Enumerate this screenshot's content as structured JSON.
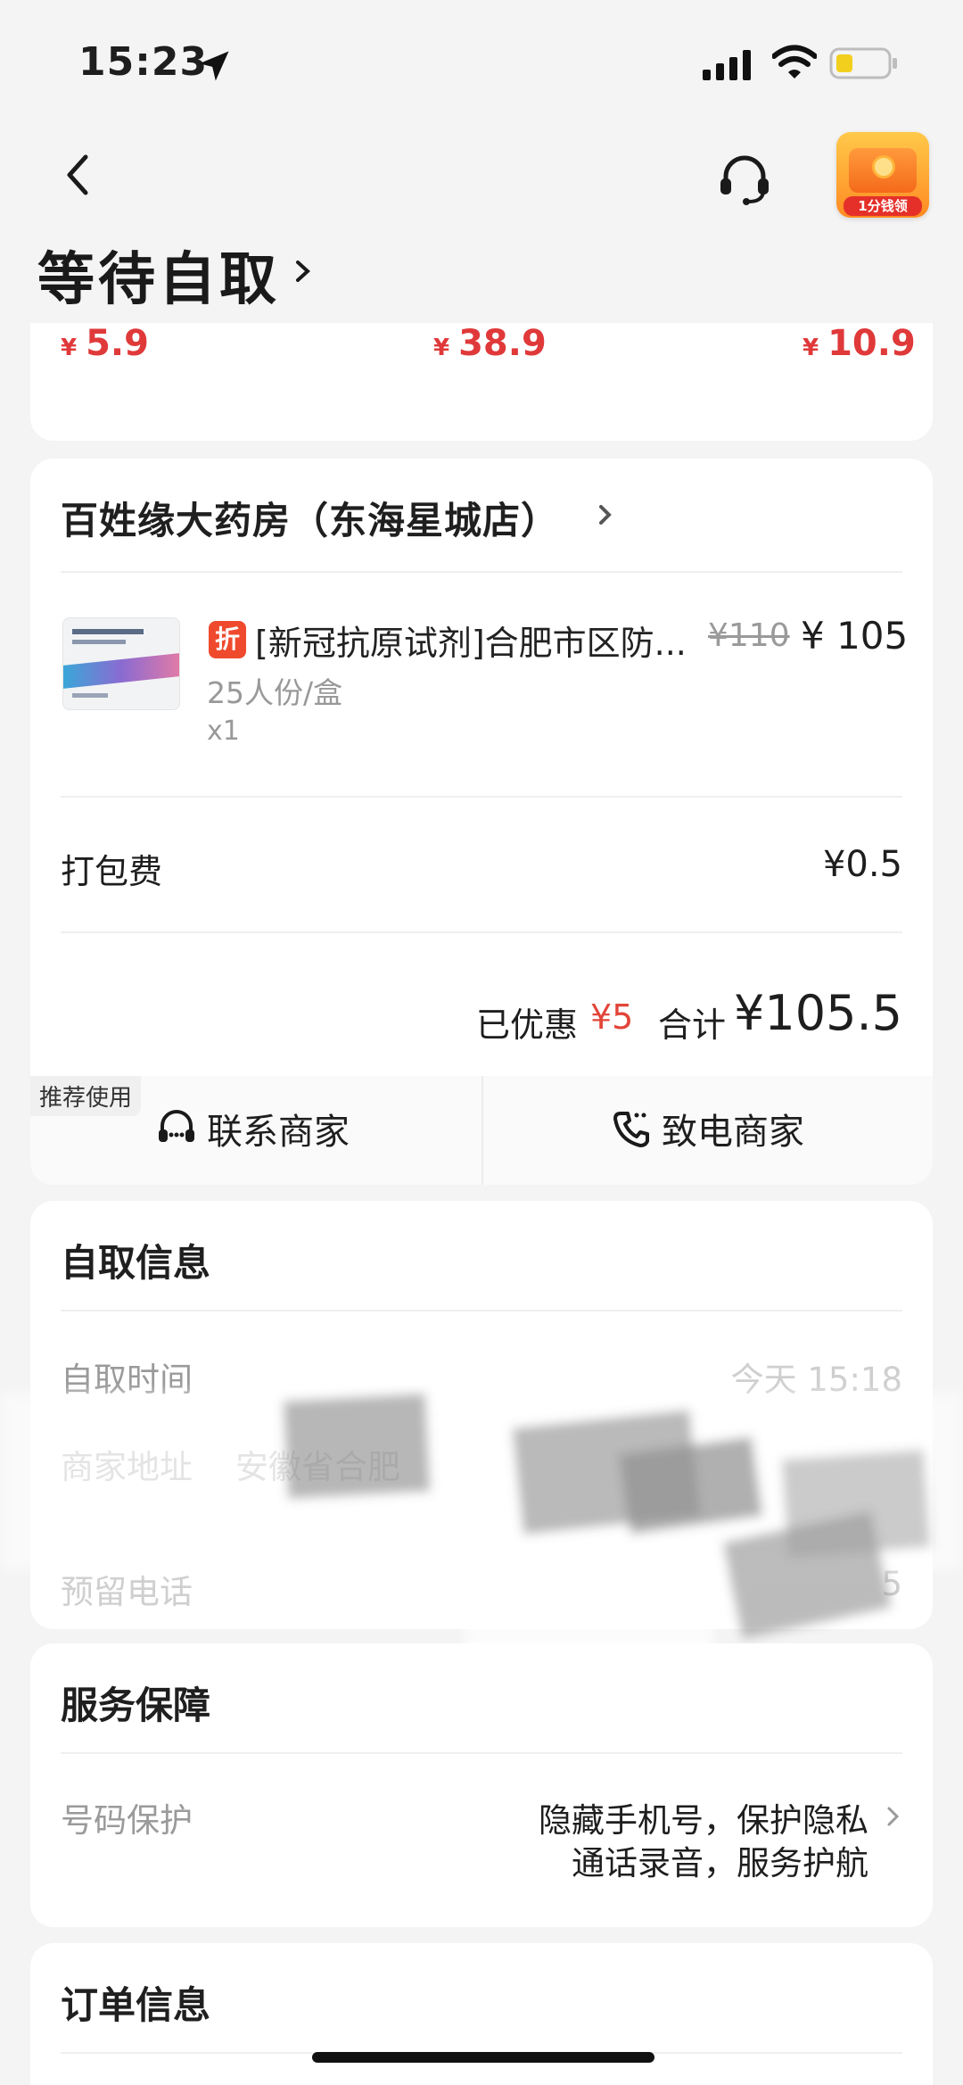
{
  "status_bar": {
    "time": "15:23"
  },
  "header": {
    "title": "等待自取",
    "promo_label": "1分钱领"
  },
  "recommend_prices": [
    {
      "currency": "¥",
      "amount": "5.9"
    },
    {
      "currency": "¥",
      "amount": "38.9"
    },
    {
      "currency": "¥",
      "amount": "10.9"
    }
  ],
  "store": {
    "name": "百姓缘大药房（东海星城店）",
    "item": {
      "badge": "折",
      "name": "[新冠抗原试剂]合肥市区防...",
      "original_price": "¥110",
      "price": "¥ 105",
      "spec": "25人份/盒",
      "quantity": "x1"
    },
    "packing_fee_label": "打包费",
    "packing_fee": "¥0.5",
    "saved_label": "已优惠",
    "saved_value": "¥5",
    "total_label": "合计",
    "total_value": "¥105.5",
    "recommend_tag": "推荐使用",
    "contact_merchant": "联系商家",
    "call_merchant": "致电商家"
  },
  "pickup_info": {
    "title": "自取信息",
    "time_label": "自取时间",
    "time_value": "今天 15:18",
    "address_label": "商家地址",
    "address_value": "安徽省合肥",
    "phone_label": "预留电话",
    "phone_value": "5"
  },
  "service": {
    "title": "服务保障",
    "label": "号码保护",
    "line1": "隐藏手机号，保护隐私",
    "line2": "通话录音，服务护航"
  },
  "order_info": {
    "title": "订单信息"
  },
  "colors": {
    "accent_red": "#e0393a",
    "badge_orange": "#ef4a2d",
    "background": "#f4f4f4"
  }
}
